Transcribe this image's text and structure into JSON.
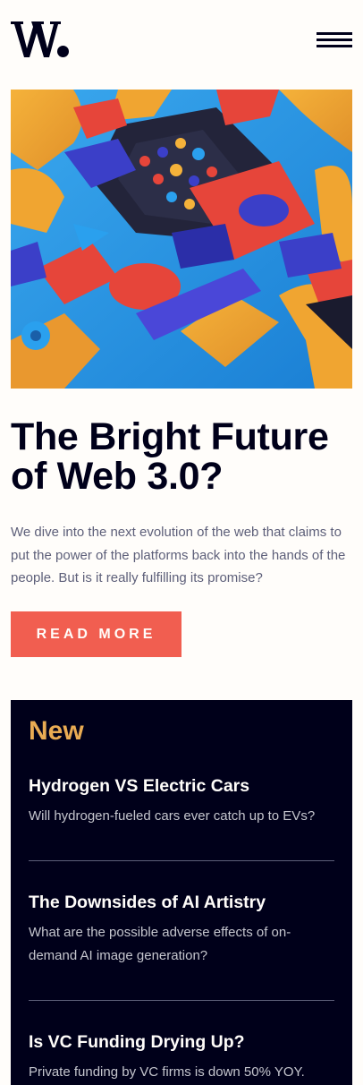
{
  "header": {
    "logo_text": "W.",
    "menu_icon": "hamburger-menu-icon"
  },
  "hero": {
    "image_description_icon": "abstract-3d-blocks-image",
    "title": "The Bright Future of Web 3.0?",
    "description": "We dive into the next evolution of the web that claims to put the power of the platforms back into the hands of the people. But is it really fulfilling its promise?",
    "cta_label": "READ MORE"
  },
  "new_section": {
    "heading": "New",
    "items": [
      {
        "title": "Hydrogen VS Electric Cars",
        "description": "Will hydrogen-fueled cars ever catch up to EVs?"
      },
      {
        "title": "The Downsides of AI Artistry",
        "description": "What are the possible adverse effects of on-demand AI image generation?"
      },
      {
        "title": "Is VC Funding Drying Up?",
        "description": "Private funding by VC firms is down 50% YOY."
      }
    ]
  },
  "colors": {
    "background": "#fffdfa",
    "text_dark": "#00001a",
    "text_muted": "#5d5f79",
    "accent_red": "#f15e50",
    "accent_orange": "#e9ab53",
    "panel_dark": "#00001a"
  }
}
